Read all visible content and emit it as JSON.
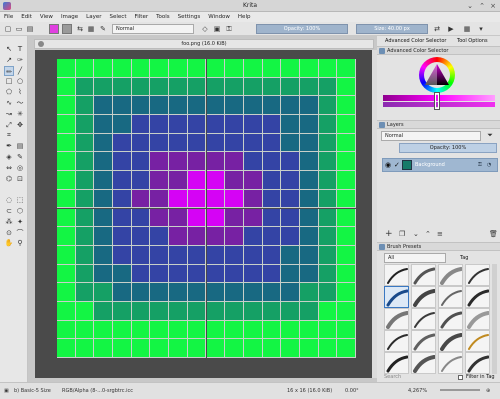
{
  "window": {
    "title": "Krita",
    "minimize_icon": "chevron-down-icon",
    "maximize_icon": "chevron-up-icon",
    "close_icon": "close-icon"
  },
  "menu": [
    "File",
    "Edit",
    "View",
    "Image",
    "Layer",
    "Select",
    "Filter",
    "Tools",
    "Settings",
    "Window",
    "Help"
  ],
  "tool_options": {
    "blend_mode": "Normal",
    "opacity_label": "Opacity: 100%",
    "size_label": "Size: 40.00 px",
    "fg_color": "#e040e0",
    "bg_color": "#9a9a9a",
    "tabs": [
      "Advanced Color Selector",
      "Tool Options"
    ]
  },
  "document": {
    "tab_label": "foo.png (16.0 KiB)"
  },
  "pixel_art": {
    "colors": {
      "lime": "#11ff44",
      "green": "#13a567",
      "teal": "#166b86",
      "blue": "#3344aa",
      "purple": "#7a1fa8",
      "magenta": "#dd00ff"
    },
    "grid_color": "#cfd8d0"
  },
  "dockers": {
    "color_selector_title": "Advanced Color Selector",
    "layers_title": "Layers",
    "layers_blend_mode": "Normal",
    "layers_opacity": "Opacity: 100%",
    "layer_name": "Background",
    "brush_presets_title": "Brush Presets",
    "brush_filter": "All",
    "brush_tag_label": "Tag",
    "brush_search_placeholder": "Search",
    "filter_in_tag_label": "Filter in Tag"
  },
  "status": {
    "brush_name": "b) Basic-5 Size",
    "color_profile": "RGB/Alpha (8-...0-srgbtrc.icc",
    "image_size": "16 x 16 (16.0 KiB)",
    "rotation": "0.00°",
    "zoom": "4,267%"
  }
}
